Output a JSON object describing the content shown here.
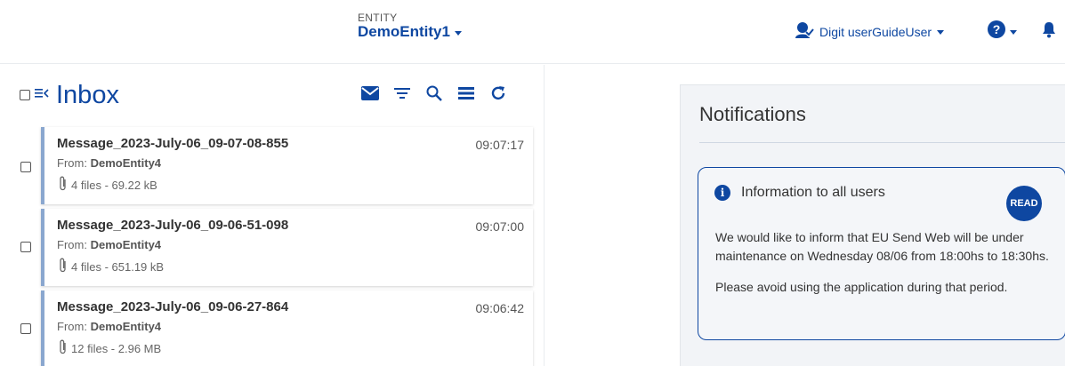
{
  "header": {
    "entity_caption": "ENTITY",
    "entity_name": "DemoEntity1",
    "user_name": "Digit userGuideUser",
    "icons": {
      "user": "user-check-icon",
      "help": "question-circle-icon",
      "bell": "bell-icon"
    }
  },
  "inbox": {
    "title": "Inbox",
    "toolbar": [
      "envelope-icon",
      "filter-icon",
      "search-icon",
      "list-icon",
      "refresh-icon"
    ],
    "messages": [
      {
        "subject": "Message_2023-July-06_09-07-08-855",
        "time": "09:07:17",
        "from_label": "From:",
        "from": "DemoEntity4",
        "files": "4 files - 69.22 kB"
      },
      {
        "subject": "Message_2023-July-06_09-06-51-098",
        "time": "09:07:00",
        "from_label": "From:",
        "from": "DemoEntity4",
        "files": "4 files - 651.19 kB"
      },
      {
        "subject": "Message_2023-July-06_09-06-27-864",
        "time": "09:06:42",
        "from_label": "From:",
        "from": "DemoEntity4",
        "files": "12 files - 2.96 MB"
      }
    ]
  },
  "notifications": {
    "title": "Notifications",
    "card": {
      "heading": "Information to all users",
      "read_label": "READ",
      "paragraph1": "We would like to inform that EU Send Web will be under maintenance on Wednesday 08/06 from 18:00hs to 18:30hs.",
      "paragraph2": "Please avoid using the application during that period."
    }
  },
  "colors": {
    "primary": "#0e47a1",
    "accent_bar": "#8aa7cf",
    "panel_bg": "#f2f4f7"
  }
}
